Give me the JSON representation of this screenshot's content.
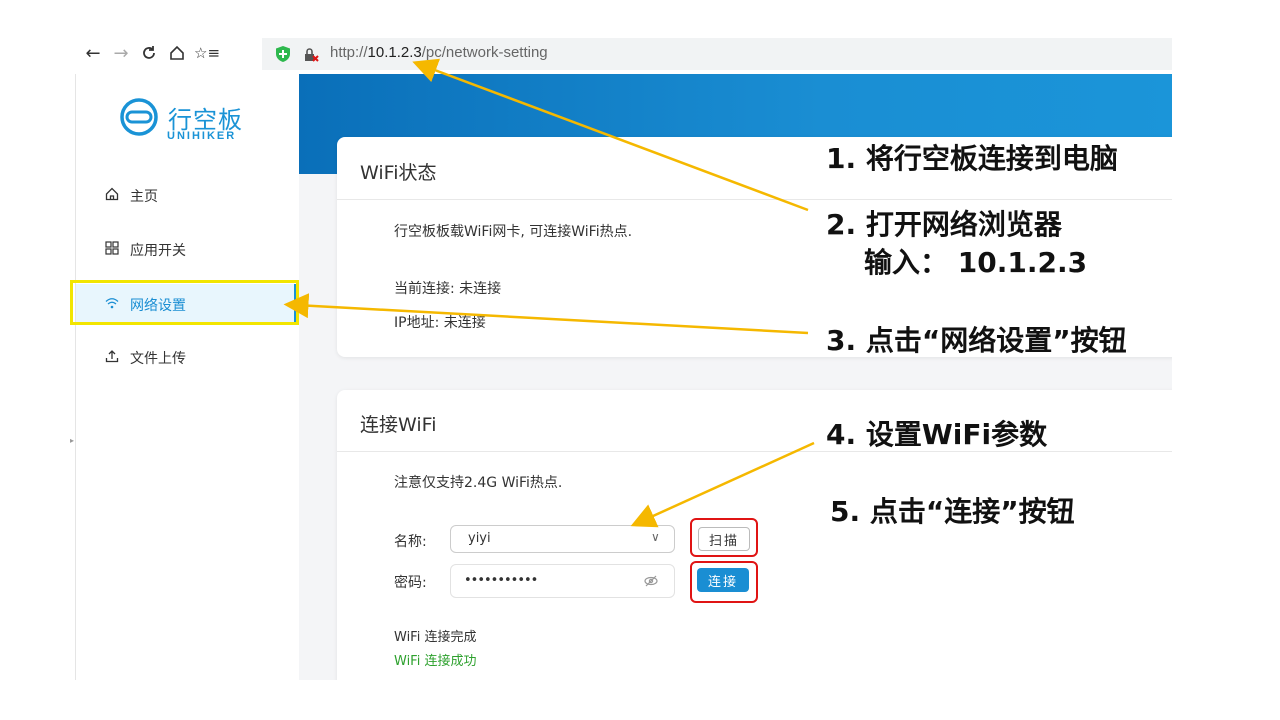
{
  "browser": {
    "url_prefix": "http://",
    "url_host": "10.1.2.3",
    "url_path": "/pc/network-setting"
  },
  "sidebar": {
    "logo_text": "行空板",
    "logo_sub": "UNIHIKER",
    "items": [
      {
        "label": "主页",
        "icon": "home-icon"
      },
      {
        "label": "应用开关",
        "icon": "grid-icon"
      },
      {
        "label": "网络设置",
        "icon": "wifi-icon",
        "active": true
      },
      {
        "label": "文件上传",
        "icon": "upload-icon"
      }
    ]
  },
  "wifi_status": {
    "title": "WiFi状态",
    "description": "行空板板载WiFi网卡, 可连接WiFi热点.",
    "current_connection": "当前连接: 未连接",
    "ip_address": "IP地址: 未连接"
  },
  "connect_wifi": {
    "title": "连接WiFi",
    "note": "注意仅支持2.4G WiFi热点.",
    "name_label": "名称:",
    "name_value": "yiyi",
    "password_label": "密码:",
    "password_value": "•••••••••••",
    "scan_button": "扫描",
    "connect_button": "连接",
    "status_complete": "WiFi 连接完成",
    "status_success": "WiFi 连接成功"
  },
  "annotations": {
    "step1": "1. 将行空板连接到电脑",
    "step2": "2. 打开网络浏览器",
    "step2b": "输入： 10.1.2.3",
    "step3": "3. 点击“网络设置”按钮",
    "step4": "4. 设置WiFi参数",
    "step5": "5. 点击“连接”按钮"
  },
  "colors": {
    "accent": "#1a8ed3",
    "active_bg": "#e8f6fd",
    "highlight_yellow": "#f2e500",
    "arrow": "#f5b800",
    "red_box": "#e01414",
    "success_green": "#2ea12e"
  }
}
